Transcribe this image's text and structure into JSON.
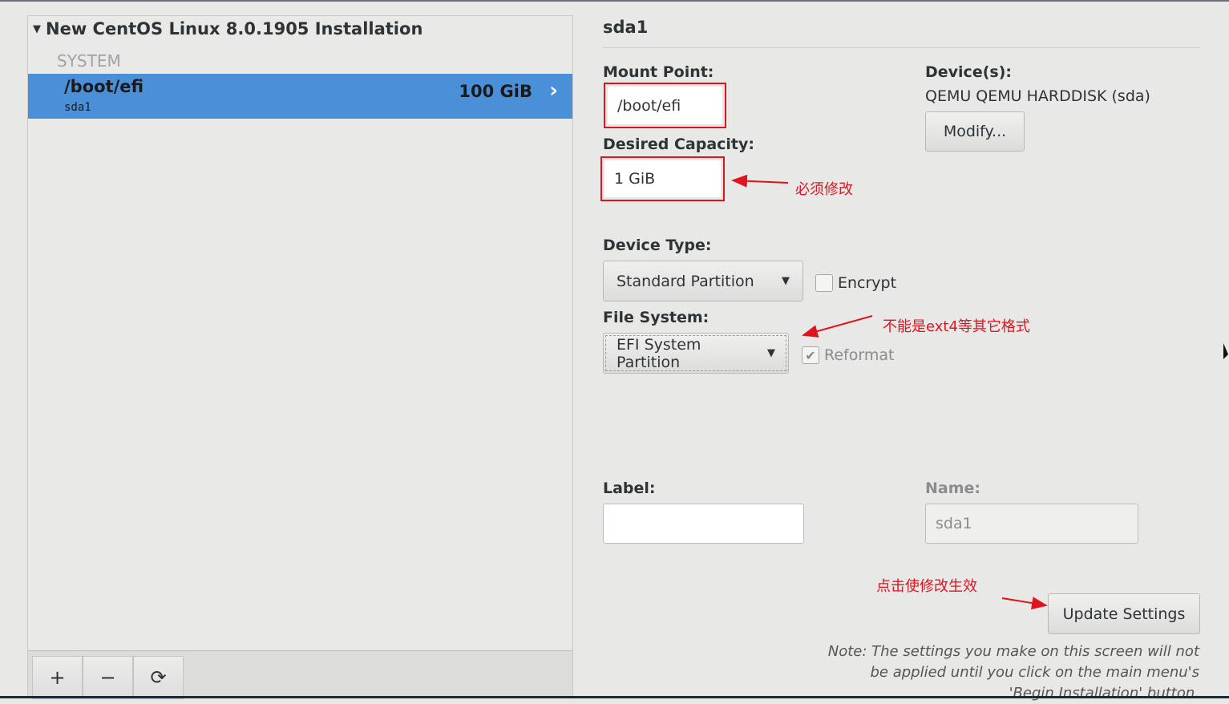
{
  "left_panel": {
    "installation_title": "New CentOS Linux 8.0.1905 Installation",
    "section": "SYSTEM",
    "selected_item": {
      "mount_point": "/boot/efi",
      "device": "sda1",
      "size": "100 GiB"
    },
    "toolbar": {
      "add": "+",
      "remove": "−",
      "refresh": "⟳"
    }
  },
  "detail": {
    "title": "sda1",
    "mount_point_label": "Mount Point:",
    "mount_point_value": "/boot/efi",
    "desired_capacity_label": "Desired Capacity:",
    "desired_capacity_value": "1 GiB",
    "devices_label": "Device(s):",
    "devices_value": "QEMU QEMU HARDDISK (sda)",
    "modify_button": "Modify...",
    "device_type_label": "Device Type:",
    "device_type_value": "Standard Partition",
    "encrypt_label": "Encrypt",
    "encrypt_checked": false,
    "file_system_label": "File System:",
    "file_system_value": "EFI System Partition",
    "reformat_label": "Reformat",
    "reformat_checked": true,
    "label_label": "Label:",
    "label_value": "",
    "name_label": "Name:",
    "name_value": "sda1",
    "update_button": "Update Settings",
    "note": "Note:  The settings you make on this screen will not be applied until you click on the main menu's 'Begin Installation' button."
  },
  "annotations": {
    "capacity": "必须修改",
    "filesystem": "不能是ext4等其它格式",
    "update": "点击使修改生效",
    "color": "#e0141e"
  }
}
